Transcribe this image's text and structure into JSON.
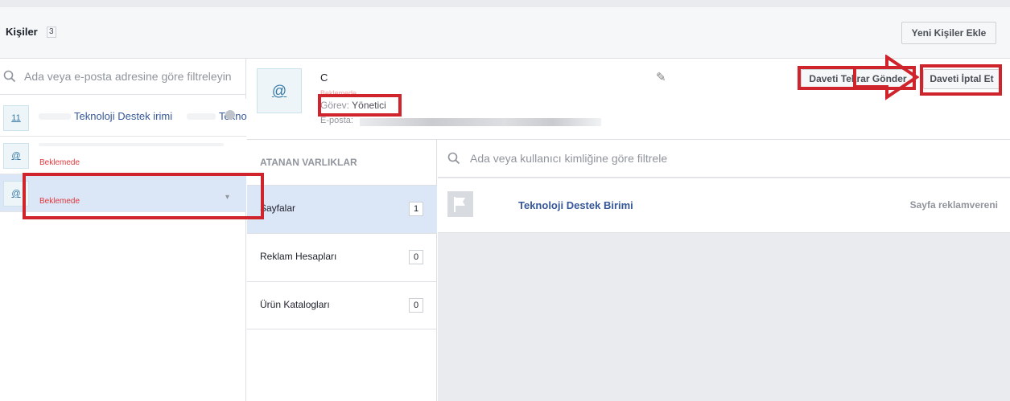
{
  "header": {
    "title": "Kişiler",
    "count": "3",
    "add_button": "Yeni Kişiler Ekle"
  },
  "people_search": {
    "placeholder": "Ada veya e-posta adresine göre filtreleyin"
  },
  "people": [
    {
      "avatar": "11",
      "name": "Teknoloji Destek irimi",
      "name_suffix": "Tekno"
    },
    {
      "avatar": "@",
      "status": "Beklemede"
    },
    {
      "avatar": "@",
      "status": "Beklemede"
    }
  ],
  "detail": {
    "avatar": "@",
    "name": "C",
    "status": "Beklemede",
    "role_label": "Görev:",
    "role_value": "Yönetici",
    "email_label": "E-posta:",
    "resend_button": "Daveti Tekrar Gönder",
    "cancel_button": "Daveti İptal Et"
  },
  "assets": {
    "heading": "ATANAN VARLIKLAR",
    "tabs": [
      {
        "label": "Sayfalar",
        "count": "1"
      },
      {
        "label": "Reklam Hesapları",
        "count": "0"
      },
      {
        "label": "Ürün Katalogları",
        "count": "0"
      }
    ]
  },
  "content": {
    "search_placeholder": "Ada veya kullanıcı kimliğine göre filtrele",
    "pages": [
      {
        "name": "Teknoloji Destek Birimi",
        "role": "Sayfa reklamvereni"
      }
    ]
  },
  "colors": {
    "annotation_red": "#d0242d",
    "link_blue": "#365899",
    "pending_red": "#e0393e",
    "selected_bg": "#dbe6f6"
  },
  "icons": [
    "search-icon",
    "pencil-icon",
    "flag-icon",
    "gear-icon",
    "chevron-down-icon",
    "arrow-right-icon"
  ]
}
